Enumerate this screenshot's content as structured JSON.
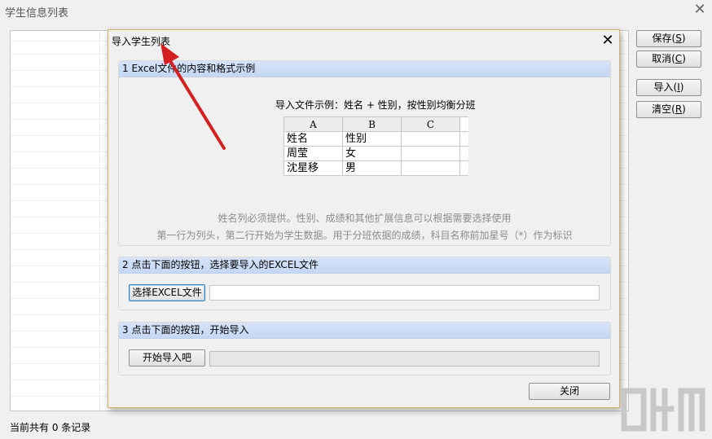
{
  "parent_window": {
    "title": "学生信息列表",
    "close_glyph": "✕",
    "status": "当前共有 0 条记录",
    "buttons": {
      "save": {
        "label": "保存(",
        "accel": "S",
        "tail": ")"
      },
      "cancel": {
        "label": "取消(",
        "accel": "C",
        "tail": ")"
      },
      "import": {
        "label": "导入(",
        "accel": "I",
        "tail": ")"
      },
      "clear": {
        "label": "清空(",
        "accel": "R",
        "tail": ")"
      }
    }
  },
  "dialog": {
    "title": "导入学生列表",
    "close_glyph": "✕",
    "section1": {
      "header": "1 Excel文件的内容和格式示例",
      "example_title": "导入文件示例：姓名 + 性别，按性别均衡分班",
      "table": {
        "columns": [
          "A",
          "B",
          "C"
        ],
        "rows": [
          [
            "姓名",
            "性别",
            ""
          ],
          [
            "周莹",
            "女",
            ""
          ],
          [
            "沈星移",
            "男",
            ""
          ]
        ]
      },
      "note1": "姓名列必须提供。性别、成绩和其他扩展信息可以根据需要选择使用",
      "note2": "第一行为列头，第二行开始为学生数据。用于分班依据的成绩，科目名称前加星号（*）作为标识"
    },
    "section2": {
      "header": "2 点击下面的按钮，选择要导入的EXCEL文件",
      "button": "选择EXCEL文件",
      "file_path": ""
    },
    "section3": {
      "header": "3 点击下面的按钮，开始导入",
      "button": "开始导入吧",
      "progress": 0
    },
    "close_button": "关闭"
  },
  "annotation": {
    "color": "#d42020"
  },
  "colors": {
    "section_header": "#c9daf6",
    "dialog_border": "#d7b169"
  }
}
